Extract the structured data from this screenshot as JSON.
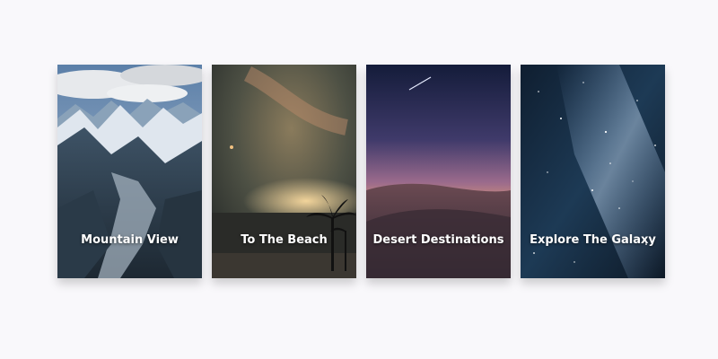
{
  "cards": [
    {
      "title": "Mountain View",
      "art": "mountain-photo"
    },
    {
      "title": "To The Beach",
      "art": "beach-night-photo"
    },
    {
      "title": "Desert Destinations",
      "art": "desert-dusk-photo"
    },
    {
      "title": "Explore The Galaxy",
      "art": "galaxy-photo"
    }
  ],
  "colors": {
    "background": "#f9f8fb",
    "title_text": "#ffffff"
  }
}
